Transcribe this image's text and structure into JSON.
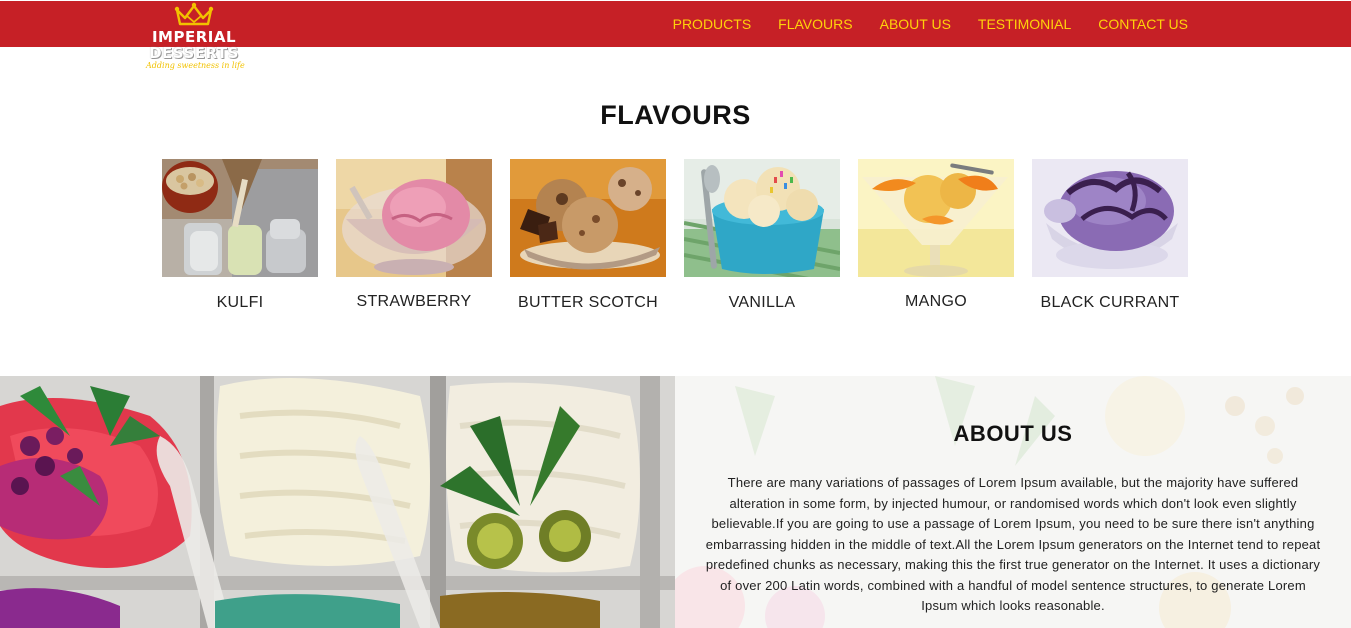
{
  "brand": {
    "name_line1": "IMPERIAL",
    "name_line2": "DESSERTS",
    "tagline": "Adding sweetness in life",
    "primary_color": "#c62026",
    "nav_color": "#ffd20a"
  },
  "nav": {
    "items": [
      {
        "label": "PRODUCTS"
      },
      {
        "label": "FLAVOURS"
      },
      {
        "label": "ABOUT US"
      },
      {
        "label": "TESTIMONIAL"
      },
      {
        "label": "CONTACT US"
      }
    ]
  },
  "flavours": {
    "title": "FLAVOURS",
    "items": [
      {
        "label": "KULFI",
        "icon": "kulfi-image"
      },
      {
        "label": "STRAWBERRY",
        "icon": "strawberry-image"
      },
      {
        "label": "BUTTER SCOTCH",
        "icon": "butter-scotch-image"
      },
      {
        "label": "VANILLA",
        "icon": "vanilla-image"
      },
      {
        "label": "MANGO",
        "icon": "mango-image"
      },
      {
        "label": "BLACK CURRANT",
        "icon": "black-currant-image"
      }
    ]
  },
  "about": {
    "title": "ABOUT US",
    "body": "There are many variations of passages of Lorem Ipsum available, but the majority have suffered alteration in some form, by injected humour, or randomised words which don't look even slightly believable.If you are going to use a passage of Lorem Ipsum, you need to be sure there isn't anything embarrassing hidden in the middle of text.All the Lorem Ipsum generators on the Internet tend to repeat predefined chunks as necessary, making this the first true generator on the Internet. It uses a dictionary of over 200 Latin words, combined with a handful of model sentence structures, to generate Lorem Ipsum which looks reasonable."
  }
}
